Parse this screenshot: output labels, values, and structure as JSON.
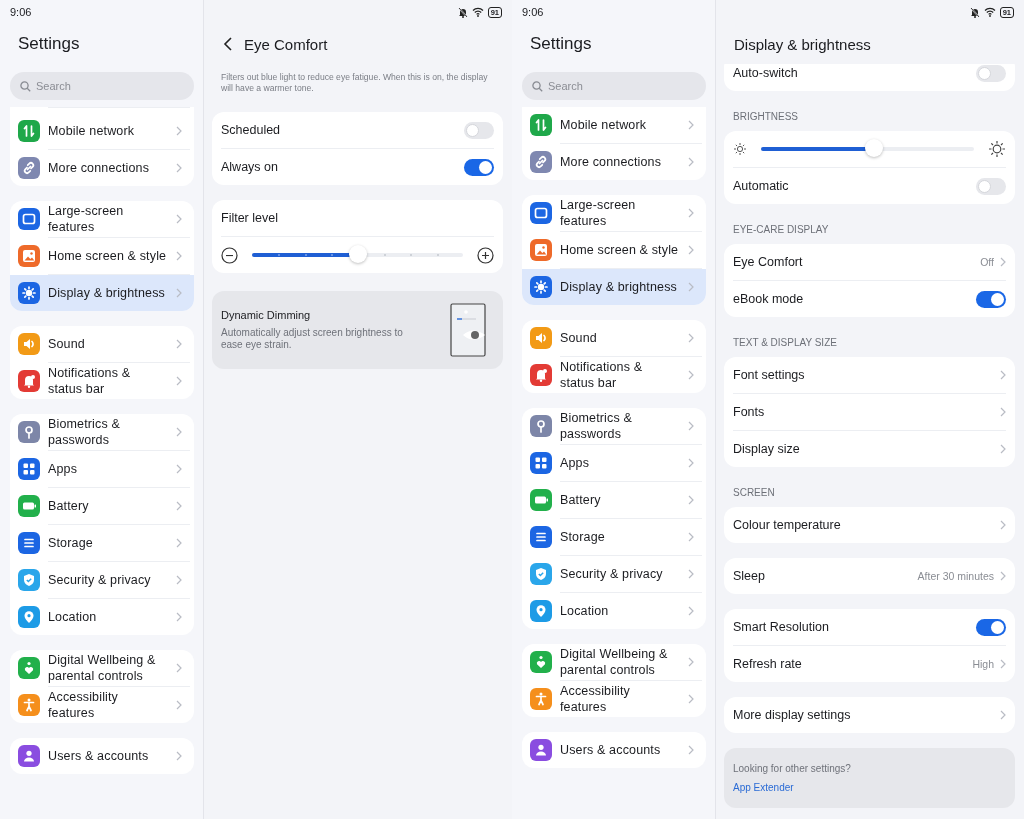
{
  "screens": [
    {
      "status_bar": {
        "time": "9:06",
        "battery": "91"
      },
      "sidebar": {
        "title": "Settings",
        "search": {
          "placeholder": "Search"
        },
        "groups": [
          {
            "items": [
              {
                "label": "Mobile network",
                "color": "#1fa84a",
                "selected": false
              },
              {
                "label": "More connections",
                "color": "#7f88b0",
                "selected": false
              }
            ]
          },
          {
            "items": [
              {
                "label": "Large-screen features",
                "color": "#1c66e3",
                "selected": false
              },
              {
                "label": "Home screen & style",
                "color": "#ee6a2a",
                "selected": false
              },
              {
                "label": "Display & brightness",
                "color": "#1c66e3",
                "selected": true
              }
            ]
          },
          {
            "items": [
              {
                "label": "Sound",
                "color": "#f29a16",
                "selected": false
              },
              {
                "label": "Notifications & status bar",
                "color": "#e33b35",
                "selected": false
              }
            ]
          },
          {
            "items": [
              {
                "label": "Biometrics & passwords",
                "color": "#7d86a8",
                "selected": false
              },
              {
                "label": "Apps",
                "color": "#1c66e3",
                "selected": false
              },
              {
                "label": "Battery",
                "color": "#22b04b",
                "selected": false
              },
              {
                "label": "Storage",
                "color": "#1c66e3",
                "selected": false
              },
              {
                "label": "Security & privacy",
                "color": "#2aa6ea",
                "selected": false
              },
              {
                "label": "Location",
                "color": "#1d9be6",
                "selected": false
              }
            ]
          },
          {
            "items": [
              {
                "label": "Digital Wellbeing & parental controls",
                "color": "#22b04b",
                "selected": false
              },
              {
                "label": "Accessibility features",
                "color": "#f58f1c",
                "selected": false
              }
            ]
          },
          {
            "items": [
              {
                "label": "Users & accounts",
                "color": "#8a4de0",
                "selected": false
              }
            ]
          }
        ]
      },
      "detail": {
        "title": "Eye Comfort",
        "back": true,
        "sections": [
          {
            "kind": "note",
            "text": "Filters out blue light to reduce eye fatigue. When this is on, the display will have a warmer tone."
          },
          {
            "kind": "card",
            "rows": [
              {
                "kind": "toggle",
                "label": "Scheduled",
                "on": false
              },
              {
                "kind": "toggle",
                "label": "Always on",
                "on": true
              }
            ]
          },
          {
            "kind": "card",
            "rows": [
              {
                "kind": "heading",
                "label": "Filter level"
              },
              {
                "kind": "stepper",
                "level": 0.5
              }
            ]
          },
          {
            "kind": "feature",
            "title": "Dynamic Dimming",
            "text": "Automatically adjust screen brightness to ease eye strain."
          }
        ]
      }
    },
    {
      "status_bar": {
        "time": "9:06",
        "battery": "91"
      },
      "sidebar": {
        "title": "Settings",
        "search": {
          "placeholder": "Search"
        },
        "groups": [
          {
            "items": [
              {
                "label": "Mobile network",
                "color": "#1fa84a",
                "selected": false
              },
              {
                "label": "More connections",
                "color": "#7f88b0",
                "selected": false
              }
            ]
          },
          {
            "items": [
              {
                "label": "Large-screen features",
                "color": "#1c66e3",
                "selected": false
              },
              {
                "label": "Home screen & style",
                "color": "#ee6a2a",
                "selected": false
              },
              {
                "label": "Display & brightness",
                "color": "#1c66e3",
                "selected": true
              }
            ]
          },
          {
            "items": [
              {
                "label": "Sound",
                "color": "#f29a16",
                "selected": false
              },
              {
                "label": "Notifications & status bar",
                "color": "#e33b35",
                "selected": false
              }
            ]
          },
          {
            "items": [
              {
                "label": "Biometrics & passwords",
                "color": "#7d86a8",
                "selected": false
              },
              {
                "label": "Apps",
                "color": "#1c66e3",
                "selected": false
              },
              {
                "label": "Battery",
                "color": "#22b04b",
                "selected": false
              },
              {
                "label": "Storage",
                "color": "#1c66e3",
                "selected": false
              },
              {
                "label": "Security & privacy",
                "color": "#2aa6ea",
                "selected": false
              },
              {
                "label": "Location",
                "color": "#1d9be6",
                "selected": false
              }
            ]
          },
          {
            "items": [
              {
                "label": "Digital Wellbeing & parental controls",
                "color": "#22b04b",
                "selected": false
              },
              {
                "label": "Accessibility features",
                "color": "#f58f1c",
                "selected": false
              }
            ]
          },
          {
            "items": [
              {
                "label": "Users & accounts",
                "color": "#8a4de0",
                "selected": false
              }
            ]
          }
        ]
      },
      "detail": {
        "title": "Display & brightness",
        "back": false,
        "sections": [
          {
            "kind": "card",
            "rows": [
              {
                "kind": "toggle",
                "label": "Auto-switch",
                "on": false
              }
            ]
          },
          {
            "kind": "header",
            "text": "BRIGHTNESS"
          },
          {
            "kind": "card",
            "rows": [
              {
                "kind": "slider",
                "level": 0.53
              },
              {
                "kind": "toggle",
                "label": "Automatic",
                "on": false
              }
            ]
          },
          {
            "kind": "header",
            "text": "EYE-CARE DISPLAY"
          },
          {
            "kind": "card",
            "rows": [
              {
                "kind": "link",
                "label": "Eye Comfort",
                "value": "Off"
              },
              {
                "kind": "toggle",
                "label": "eBook mode",
                "on": true
              }
            ]
          },
          {
            "kind": "header",
            "text": "TEXT & DISPLAY SIZE"
          },
          {
            "kind": "card",
            "rows": [
              {
                "kind": "link",
                "label": "Font settings"
              },
              {
                "kind": "link",
                "label": "Fonts"
              },
              {
                "kind": "link",
                "label": "Display size"
              }
            ]
          },
          {
            "kind": "header",
            "text": "SCREEN"
          },
          {
            "kind": "card",
            "rows": [
              {
                "kind": "link",
                "label": "Colour temperature"
              }
            ]
          },
          {
            "kind": "card",
            "rows": [
              {
                "kind": "link",
                "label": "Sleep",
                "value": "After 30 minutes"
              }
            ]
          },
          {
            "kind": "card",
            "rows": [
              {
                "kind": "toggle",
                "label": "Smart Resolution",
                "on": true
              },
              {
                "kind": "link",
                "label": "Refresh rate",
                "value": "High"
              }
            ]
          },
          {
            "kind": "card",
            "rows": [
              {
                "kind": "link",
                "label": "More display settings"
              }
            ]
          },
          {
            "kind": "info",
            "text": "Looking for other settings?",
            "link": "App Extender"
          }
        ]
      }
    }
  ]
}
